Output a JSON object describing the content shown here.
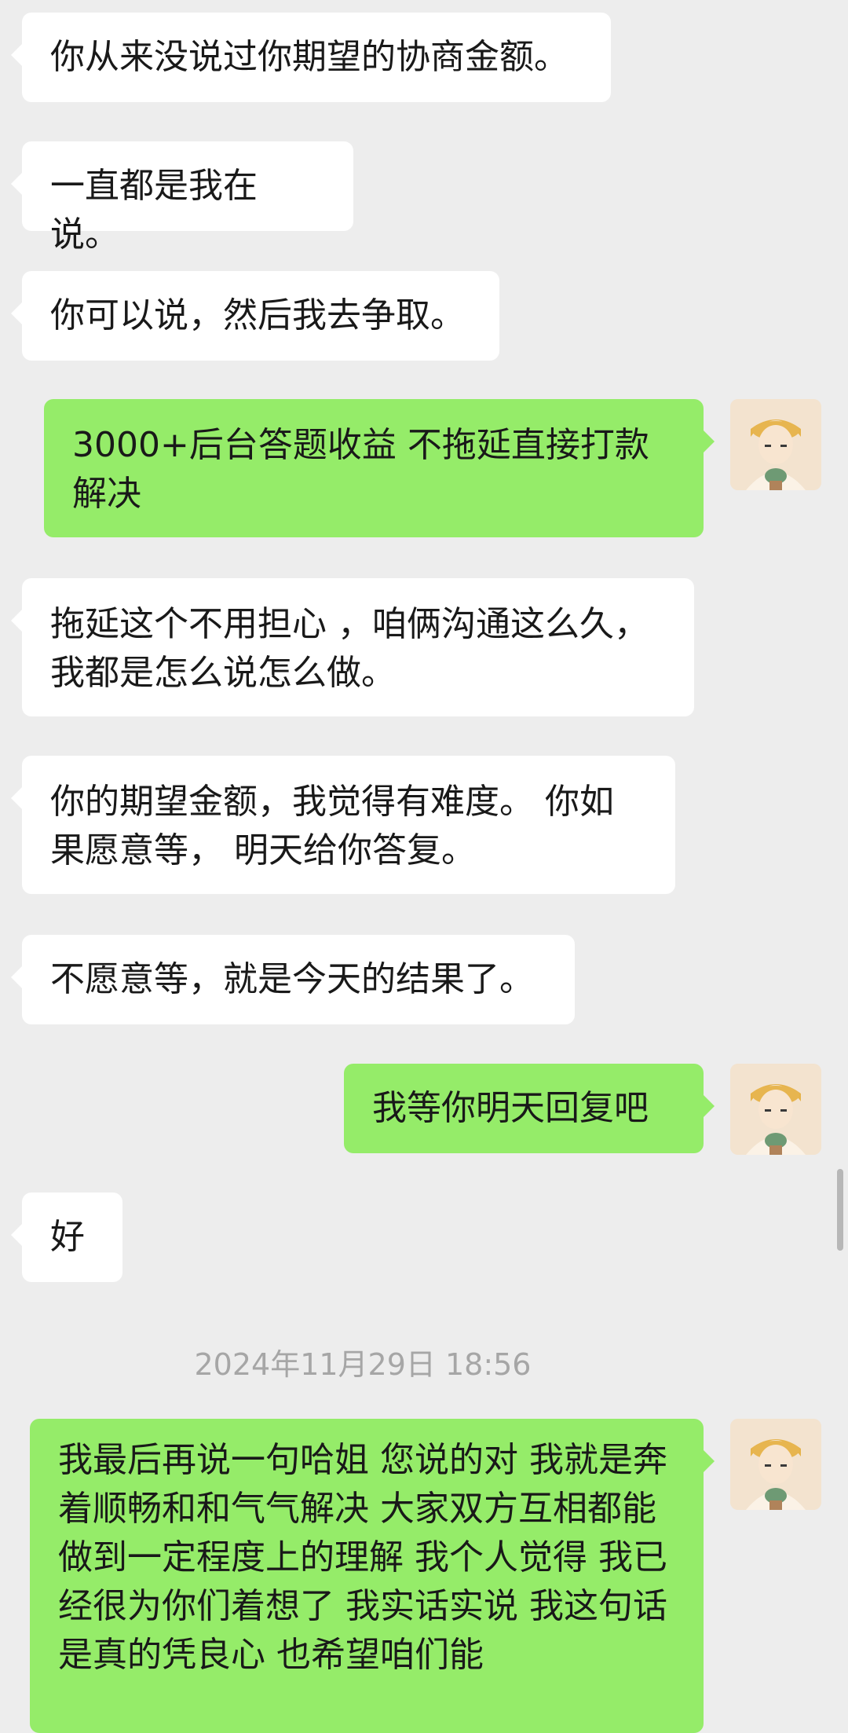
{
  "messages": [
    {
      "side": "in",
      "text": "你从来没说过你期望的协商金额。"
    },
    {
      "side": "in",
      "text": "一直都是我在说。"
    },
    {
      "side": "in",
      "text": "你可以说，然后我去争取。"
    },
    {
      "side": "out",
      "text": "3000+后台答题收益 不拖延直接打款解决"
    },
    {
      "side": "in",
      "text": "拖延这个不用担心 ，咱俩沟通这么久，我都是怎么说怎么做。"
    },
    {
      "side": "in",
      "text": "你的期望金额，我觉得有难度。 你如果愿意等， 明天给你答复。"
    },
    {
      "side": "in",
      "text": "不愿意等，就是今天的结果了。"
    },
    {
      "side": "out",
      "text": "我等你明天回复吧"
    },
    {
      "side": "in",
      "text": "好"
    },
    {
      "side": "out",
      "text": "我最后再说一句哈姐 您说的对 我就是奔着顺畅和和气气解决 大家双方互相都能做到一定程度上的理解 我个人觉得 我已经很为你们着想了 我实话实说 我这句话是真的凭良心 也希望咱们能"
    }
  ],
  "timestamp": "2024年11月29日 18:56",
  "colors": {
    "background": "#ededed",
    "incoming_bubble": "#ffffff",
    "outgoing_bubble": "#95ec69",
    "timestamp_text": "#a6a6a6"
  },
  "icons": {
    "avatar": "user-avatar-illustration"
  }
}
